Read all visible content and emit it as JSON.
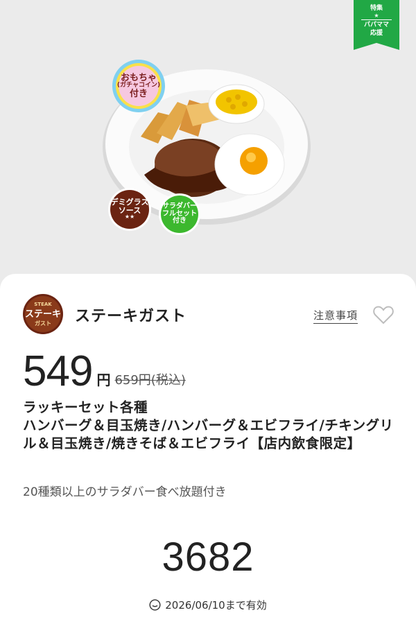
{
  "corner_tag": {
    "line1": "特集",
    "star": "★",
    "line2": "パパママ",
    "line3": "応援",
    "color": "#21a845"
  },
  "badges": {
    "toy": {
      "line1": "おもちゃ",
      "line2": "(ガチャコイン)",
      "line3": "付き"
    },
    "demi": {
      "line1": "デミグラス",
      "line2": "ソース",
      "stars": "★★"
    },
    "salad": {
      "line1": "サラダバー",
      "line2": "フルセット",
      "line3": "付き"
    }
  },
  "brand": {
    "logo_top": "STEAK",
    "logo_main": "ステーキ",
    "logo_bottom": "ガスト",
    "name": "ステーキガスト"
  },
  "notes_link": "注意事項",
  "favorite_icon": "heart-outline-icon",
  "price": {
    "value": "549",
    "unit": "円",
    "original": "659円(税込)"
  },
  "title": "ラッキーセット各種\nハンバーグ＆目玉焼き/ハンバーグ＆エビフライ/チキングリル＆目玉焼き/焼きそば＆エビフライ【店内飲食限定】",
  "subtitle": "20種類以上のサラダバー食べ放題付き",
  "coupon_code": "3682",
  "expiry": "2026/06/10まで有効",
  "colors": {
    "accent_green": "#21a845",
    "badge_brown": "#6b2412",
    "badge_green": "#3cb82e"
  }
}
